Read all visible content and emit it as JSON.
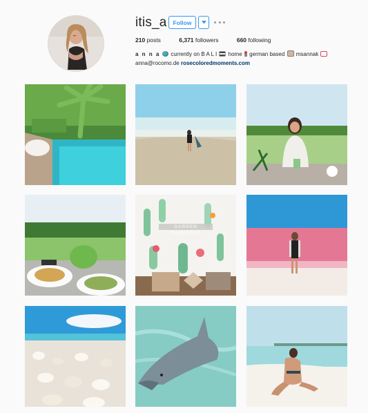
{
  "profile": {
    "username": "itis_a",
    "follow_label": "Follow",
    "posts_count": "210",
    "posts_label": "posts",
    "followers_count": "6,371",
    "followers_label": "followers",
    "following_count": "660",
    "following_label": "following",
    "full_name": "a n n a",
    "bio_part1": "currently on B A L I",
    "bio_part2": "home",
    "bio_part3": "german based",
    "bio_part4": "msannak",
    "email": "anna@rocomo.de",
    "website": "rosecoloredmoments.com"
  },
  "icons": {
    "globe": "globe-icon",
    "flag": "flag-icon",
    "pin": "round-pushpin-icon",
    "bag": "id-card-icon",
    "heart": "envelope-heart-icon",
    "dropdown": "chevron-down-icon",
    "more": "more-horizontal-icon"
  },
  "grid": {
    "posts": [
      {
        "id": "pool-villa",
        "scene": "tropical pool with palm tree"
      },
      {
        "id": "beach-walk",
        "scene": "woman walking on beach"
      },
      {
        "id": "rice-field-cafe",
        "scene": "woman at cafe with rice field"
      },
      {
        "id": "salad-coconut",
        "scene": "salads and coconut near rice field"
      },
      {
        "id": "garden-gangstas",
        "scene": "cactus illustration pillow",
        "overlay_text": "GARDEN GANGSTAS"
      },
      {
        "id": "pink-lake",
        "scene": "woman at pink lake"
      },
      {
        "id": "shell-beach",
        "scene": "white shells on beach"
      },
      {
        "id": "dolphin",
        "scene": "dolphin in water"
      },
      {
        "id": "sandbank",
        "scene": "woman sitting on sandbar"
      }
    ]
  },
  "colors": {
    "accent": "#3897f0",
    "link": "#003569",
    "background": "#fafafa"
  }
}
